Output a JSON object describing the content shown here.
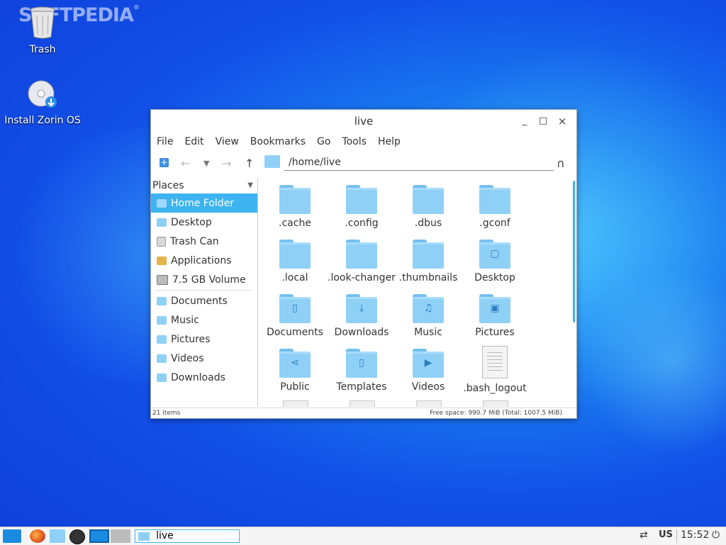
{
  "watermark": "SOFTPEDIA",
  "desktop": {
    "icons": [
      {
        "label": "Trash",
        "icon": "trash-icon"
      },
      {
        "label": "Install Zorin OS",
        "icon": "disc-icon"
      }
    ]
  },
  "window": {
    "title": "live",
    "controls": {
      "minimize": "_",
      "maximize": "□",
      "close": "×"
    },
    "menu": [
      "File",
      "Edit",
      "View",
      "Bookmarks",
      "Go",
      "Tools",
      "Help"
    ],
    "path": "/home/live",
    "sidebar": {
      "header": "Places",
      "items": [
        {
          "label": "Home Folder",
          "icon": "home-icon",
          "selected": true
        },
        {
          "label": "Desktop",
          "icon": "desktop-icon"
        },
        {
          "label": "Trash Can",
          "icon": "trash-icon"
        },
        {
          "label": "Applications",
          "icon": "applications-icon"
        },
        {
          "label": "7.5 GB Volume",
          "icon": "drive-icon"
        }
      ],
      "bookmarks": [
        {
          "label": "Documents",
          "icon": "documents-icon"
        },
        {
          "label": "Music",
          "icon": "music-icon"
        },
        {
          "label": "Pictures",
          "icon": "pictures-icon"
        },
        {
          "label": "Videos",
          "icon": "videos-icon"
        },
        {
          "label": "Downloads",
          "icon": "downloads-icon"
        }
      ]
    },
    "files": [
      {
        "name": ".cache",
        "type": "folder",
        "glyph": ""
      },
      {
        "name": ".config",
        "type": "folder",
        "glyph": ""
      },
      {
        "name": ".dbus",
        "type": "folder",
        "glyph": ""
      },
      {
        "name": ".gconf",
        "type": "folder",
        "glyph": ""
      },
      {
        "name": ".local",
        "type": "folder",
        "glyph": ""
      },
      {
        "name": ".look-changer",
        "type": "folder",
        "glyph": ""
      },
      {
        "name": ".thumbnails",
        "type": "folder",
        "glyph": ""
      },
      {
        "name": "Desktop",
        "type": "folder",
        "glyph": "▢"
      },
      {
        "name": "Documents",
        "type": "folder",
        "glyph": "▯"
      },
      {
        "name": "Downloads",
        "type": "folder",
        "glyph": "⤓"
      },
      {
        "name": "Music",
        "type": "folder",
        "glyph": "♫"
      },
      {
        "name": "Pictures",
        "type": "folder",
        "glyph": "▣"
      },
      {
        "name": "Public",
        "type": "folder",
        "glyph": "⋖"
      },
      {
        "name": "Templates",
        "type": "folder",
        "glyph": "▯"
      },
      {
        "name": "Videos",
        "type": "folder",
        "glyph": "▶"
      },
      {
        "name": ".bash_logout",
        "type": "file",
        "glyph": ""
      }
    ],
    "status": {
      "items": "21 items",
      "free": "Free space: 990.7 MiB (Total: 1007.5 MiB)"
    }
  },
  "taskbar": {
    "task": "live",
    "keyboard": "US",
    "clock": "15:52"
  },
  "colors": {
    "accent": "#3db4f0",
    "folder": "#8fd0f7"
  }
}
